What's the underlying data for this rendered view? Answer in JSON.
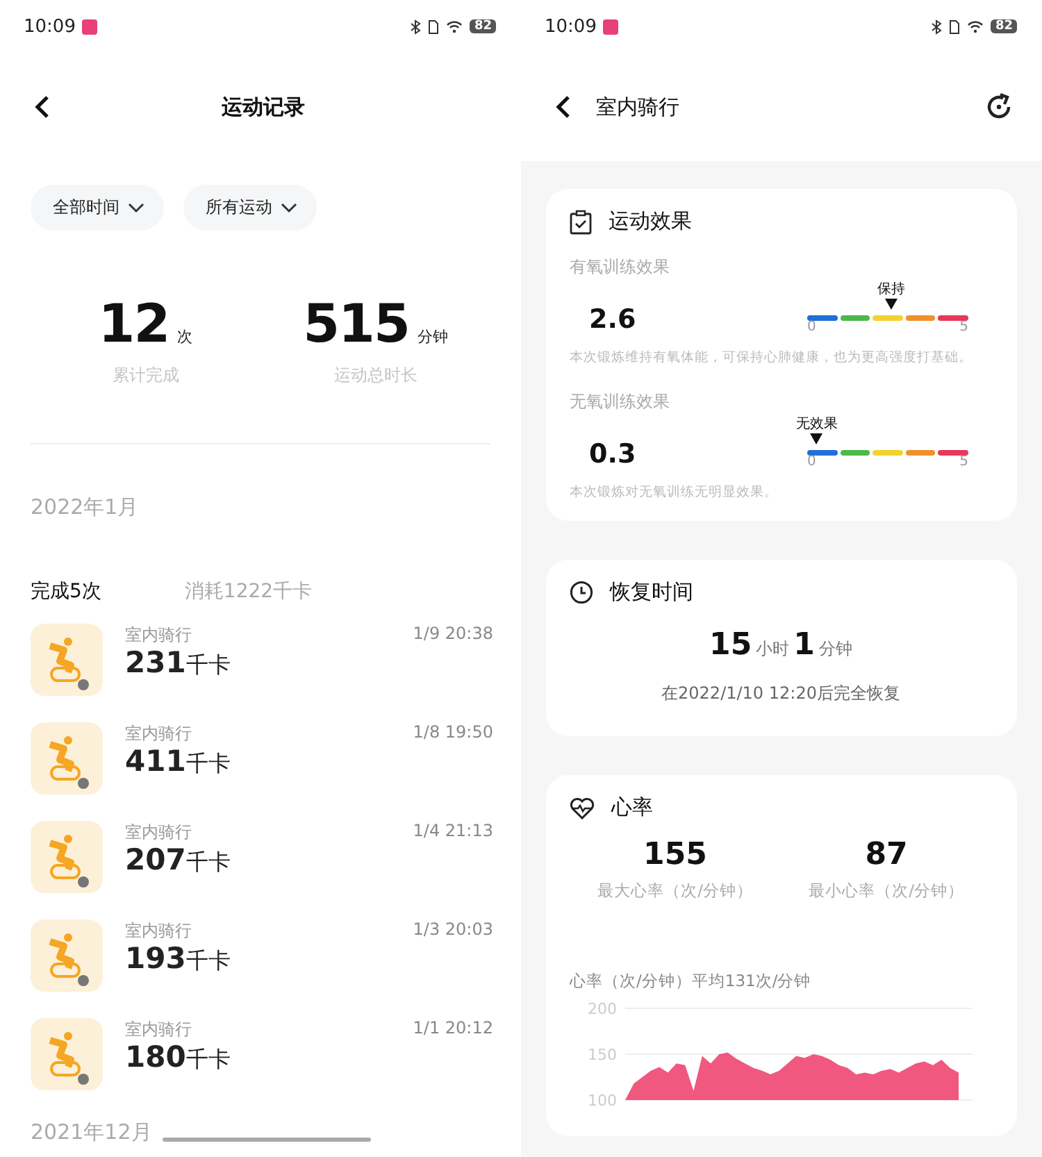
{
  "left_screen": {
    "status_bar": {
      "time": "10:09",
      "battery": "82"
    },
    "header": {
      "title": "运动记录"
    },
    "filters": [
      {
        "label": "全部时间"
      },
      {
        "label": "所有运动"
      }
    ],
    "stats": [
      {
        "value": "12",
        "unit": "次",
        "label": "累计完成"
      },
      {
        "value": "515",
        "unit": "分钟",
        "label": "运动总时长"
      }
    ],
    "month": "2022年1月",
    "summary": {
      "count": "完成5次",
      "calories": "消耗1222千卡"
    },
    "records": [
      {
        "type": "室内骑行",
        "value": "231",
        "unit": "千卡",
        "time": "1/9  20:38"
      },
      {
        "type": "室内骑行",
        "value": "411",
        "unit": "千卡",
        "time": "1/8  19:50"
      },
      {
        "type": "室内骑行",
        "value": "207",
        "unit": "千卡",
        "time": "1/4  21:13"
      },
      {
        "type": "室内骑行",
        "value": "193",
        "unit": "千卡",
        "time": "1/3  20:03"
      },
      {
        "type": "室内骑行",
        "value": "180",
        "unit": "千卡",
        "time": "1/1  20:12"
      }
    ],
    "next_month": "2021年12月"
  },
  "right_screen": {
    "status_bar": {
      "time": "10:09",
      "battery": "82"
    },
    "header": {
      "title": "室内骑行"
    },
    "effect_card": {
      "title": "运动效果",
      "items": [
        {
          "label": "有氧训练效果",
          "value": "2.6",
          "marker": "保持",
          "min": "0",
          "max": "5",
          "note": "本次锻炼维持有氧体能，可保持心肺健康，也为更高强度打基础。"
        },
        {
          "label": "无氧训练效果",
          "value": "0.3",
          "marker": "无效果",
          "min": "0",
          "max": "5",
          "note": "本次锻炼对无氧训练无明显效果。"
        }
      ]
    },
    "recovery_card": {
      "title": "恢复时间",
      "hours": "15",
      "hours_unit": "小时",
      "minutes": "1",
      "minutes_unit": "分钟",
      "note": "在2022/1/10  12:20后完全恢复"
    },
    "heart_card": {
      "title": "心率",
      "stats": [
        {
          "value": "155",
          "label": "最大心率（次/分钟）"
        },
        {
          "value": "87",
          "label": "最小心率（次/分钟）"
        }
      ],
      "chart_caption": "心率（次/分钟）平均131次/分钟",
      "chart_data": {
        "type": "area",
        "ylim": [
          100,
          200
        ],
        "yticks": [
          100,
          150,
          200
        ],
        "series": [
          {
            "color": "#f0587f",
            "values": [
              100,
              118,
              125,
              132,
              136,
              130,
              140,
              138,
              110,
              148,
              140,
              150,
              152,
              145,
              140,
              135,
              132,
              128,
              132,
              140,
              148,
              146,
              150,
              148,
              144,
              138,
              135,
              128,
              130,
              128,
              132,
              134,
              130,
              135,
              140,
              142,
              138,
              144,
              135,
              130
            ]
          }
        ]
      }
    }
  }
}
